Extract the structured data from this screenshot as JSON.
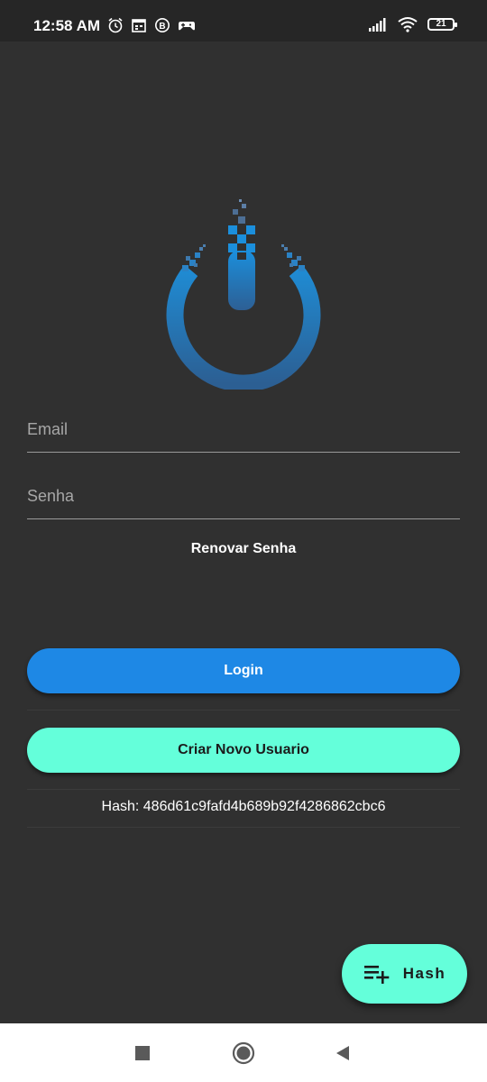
{
  "status_bar": {
    "time": "12:58 AM",
    "battery_level": "21",
    "left_icons": [
      "alarm-icon",
      "calendar-icon",
      "b-badge-icon",
      "game-controller-icon"
    ],
    "right_icons": [
      "signal-icon",
      "wifi-icon",
      "battery-icon"
    ]
  },
  "logo": {
    "name": "power-logo",
    "colors": {
      "primary": "#1a7fc0",
      "dark": "#2f5f8f"
    }
  },
  "form": {
    "email_placeholder": "Email",
    "password_placeholder": "Senha",
    "renew_password": "Renovar Senha"
  },
  "buttons": {
    "login": "Login",
    "create_user": "Criar Novo Usuario"
  },
  "hash": {
    "label": "Hash: 486d61c9fafd4b689b92f4286862cbc6"
  },
  "fab": {
    "label": "Hash",
    "icon": "playlist-add-icon"
  },
  "colors": {
    "background": "#303030",
    "login_button": "#1e88e5",
    "accent": "#64ffda"
  },
  "nav_bar": {
    "icons": [
      "recents-square-icon",
      "home-circle-icon",
      "back-triangle-icon"
    ]
  }
}
